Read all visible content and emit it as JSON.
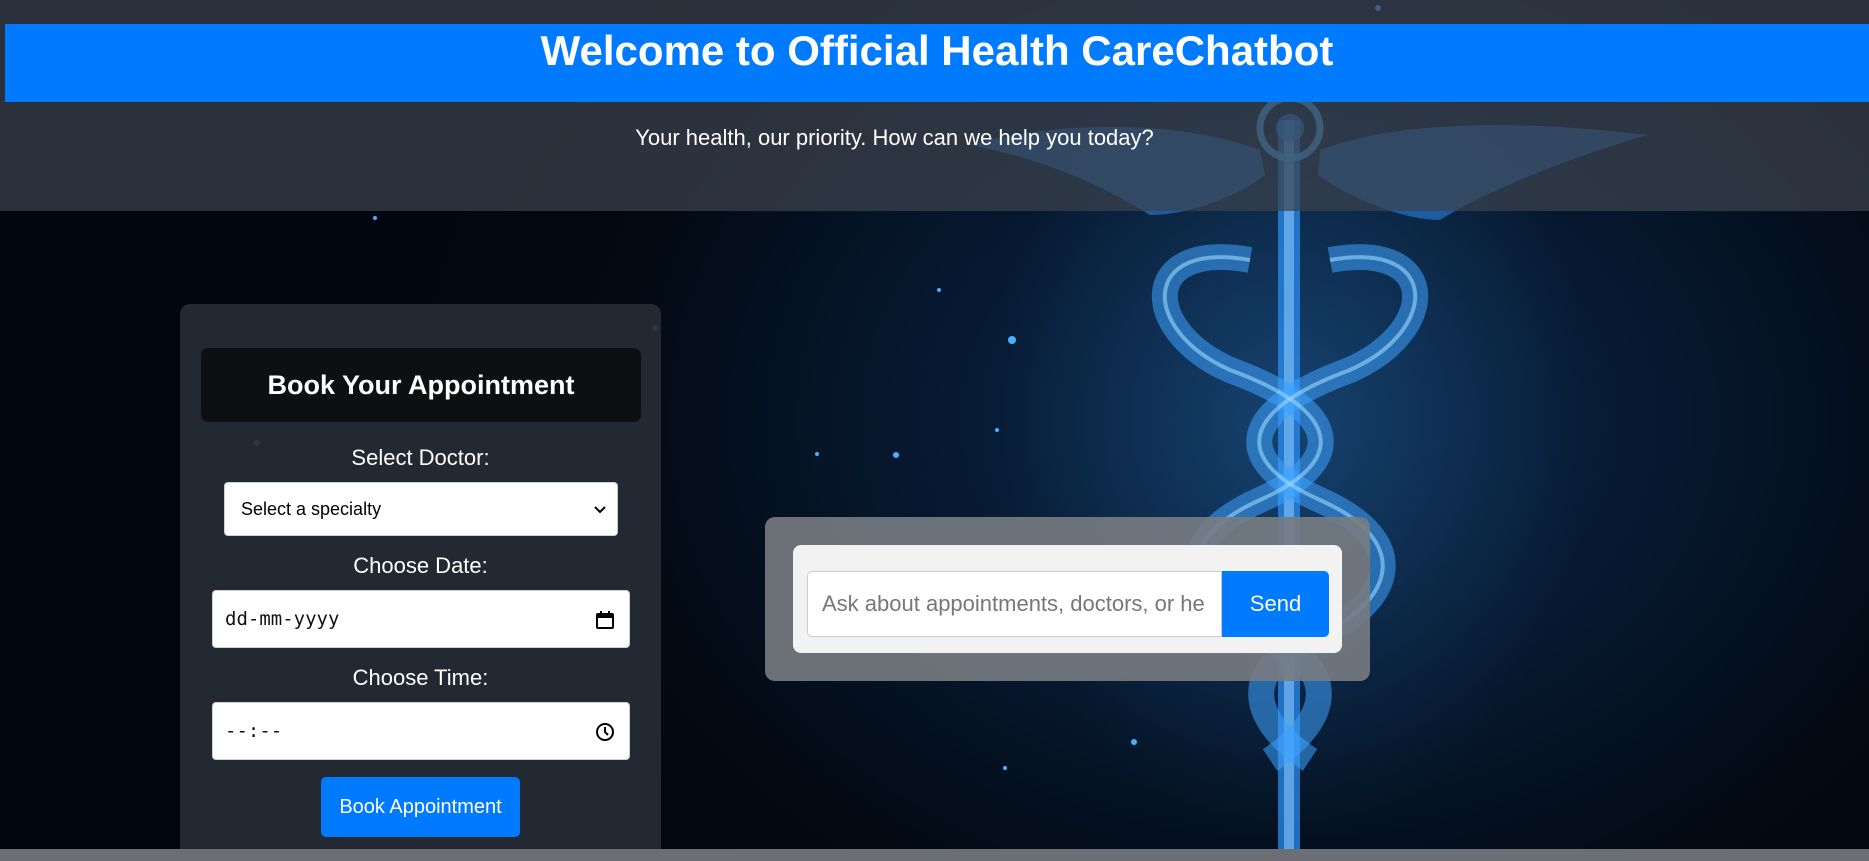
{
  "header": {
    "title": "Welcome to Official Health CareChatbot",
    "subtitle": "Your health, our priority. How can we help you today?"
  },
  "appointment": {
    "title": "Book Your Appointment",
    "doctor_label": "Select Doctor:",
    "doctor_select_value": "Select a specialty",
    "date_label": "Choose Date:",
    "date_value": "dd-mm-yyyy",
    "time_label": "Choose Time:",
    "time_value": "--:--",
    "book_button": "Book Appointment"
  },
  "chat": {
    "placeholder": "Ask about appointments, doctors, or he",
    "send_button": "Send"
  },
  "icons": {
    "background": "caduceus-icon",
    "select_arrow": "chevron-down-icon",
    "date": "calendar-icon",
    "time": "clock-icon"
  },
  "colors": {
    "accent": "#007bff",
    "panel": "#262c36",
    "background": "#050d1a"
  }
}
